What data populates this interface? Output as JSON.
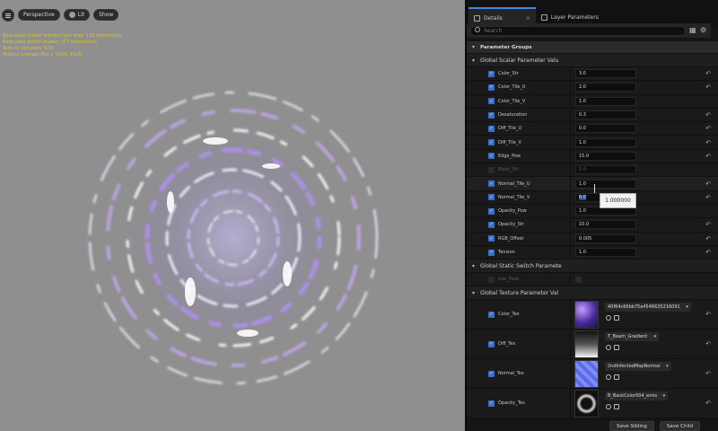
{
  "viewport": {
    "buttons": {
      "perspective": "Perspective",
      "lit": "Lit",
      "show": "Show"
    },
    "stats": [
      "Base pass shader without light map: 116 instructions",
      "Base pass vertex shader: 217 instructions",
      "Texture samplers: 5/16",
      "Texture Lookups (Est.): VS(0), PS(8)"
    ]
  },
  "panel": {
    "tabs": {
      "details": "Details",
      "layer_parameters": "Layer Parameters"
    },
    "search_placeholder": "Search",
    "parameter_groups": "Parameter Groups",
    "scalar_group": "Global Scalar Parameter Valu",
    "scalar_params": [
      {
        "name": "Color_Str",
        "value": "3.0",
        "checked": true,
        "enabled": true,
        "reset": true
      },
      {
        "name": "Color_Tile_U",
        "value": "2.0",
        "checked": true,
        "enabled": true,
        "reset": true
      },
      {
        "name": "Color_Tile_V",
        "value": "1.0",
        "checked": true,
        "enabled": true,
        "reset": false
      },
      {
        "name": "Desaturation",
        "value": "0.3",
        "checked": true,
        "enabled": true,
        "reset": true
      },
      {
        "name": "Diff_Tile_U",
        "value": "0.0",
        "checked": true,
        "enabled": true,
        "reset": true
      },
      {
        "name": "Diff_Tile_V",
        "value": "1.0",
        "checked": true,
        "enabled": true,
        "reset": true
      },
      {
        "name": "Edge_Pow",
        "value": "15.0",
        "checked": true,
        "enabled": true,
        "reset": true
      },
      {
        "name": "Mask_Str",
        "value": "5.0",
        "checked": false,
        "enabled": false,
        "reset": false
      },
      {
        "name": "Normal_Tile_U",
        "value": "1.0",
        "checked": true,
        "enabled": true,
        "reset": true
      },
      {
        "name": "Normal_Tile_V",
        "value": "0.0",
        "checked": true,
        "enabled": true,
        "reset": true
      },
      {
        "name": "Opacity_Pow",
        "value": "1.0",
        "checked": true,
        "enabled": true,
        "reset": false
      },
      {
        "name": "Opacity_Str",
        "value": "10.0",
        "checked": true,
        "enabled": true,
        "reset": true
      },
      {
        "name": "RGB_Offset",
        "value": "0.005",
        "checked": true,
        "enabled": true,
        "reset": true
      },
      {
        "name": "Tension",
        "value": "1.0",
        "checked": true,
        "enabled": true,
        "reset": true
      }
    ],
    "tooltip_value": "1.000000",
    "switch_group": "Global Static Switch Paramete",
    "switch_params": [
      {
        "name": "Use_Fade",
        "checked": false
      }
    ],
    "texture_group": "Global Texture Parameter Val",
    "texture_params": [
      {
        "name": "Color_Tex",
        "asset": "40f64c66bb75a4546635216091",
        "thumb": "color"
      },
      {
        "name": "Diff_Tex",
        "asset": "T_Beam_Gradient",
        "thumb": "diff"
      },
      {
        "name": "Normal_Tex",
        "asset": "2ndInfectedMapNormal",
        "thumb": "normal"
      },
      {
        "name": "Opacity_Tex",
        "asset": "B_BackColor004_emis",
        "thumb": "opacity"
      }
    ],
    "bottom_buttons": {
      "save_sibling": "Save Sibling",
      "save_child": "Save Child"
    }
  }
}
